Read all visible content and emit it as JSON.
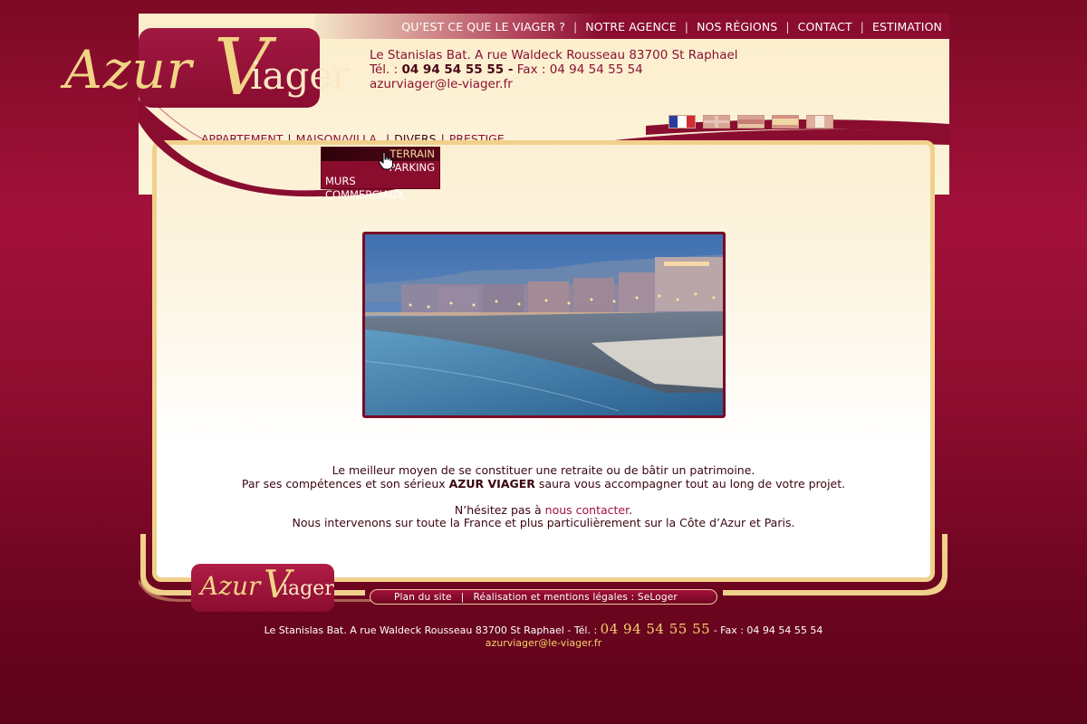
{
  "brand": {
    "logo_part1": "Azur",
    "logo_part2": "V",
    "logo_part3": "iager",
    "colors": {
      "primary": "#8a0d30",
      "gold": "#f1d486",
      "cream": "#fdf3dc"
    }
  },
  "topnav": {
    "items": [
      {
        "label": "QU’EST CE QUE LE VIAGER ?"
      },
      {
        "label": "NOTRE AGENCE"
      },
      {
        "label": "NOS RÉGIONS"
      },
      {
        "label": "CONTACT"
      },
      {
        "label": "ESTIMATION"
      }
    ],
    "separator": "|"
  },
  "contact": {
    "address": "Le Stanislas Bat. A rue Waldeck Rousseau 83700 St Raphael",
    "tel_label": "Tél. :",
    "tel_number": "04 94 54 55 55 -",
    "fax": "Fax : 04 94 54 55 54",
    "email": "azurviager@le-viager.fr"
  },
  "languages": [
    {
      "icon": "flag-fr-icon"
    },
    {
      "icon": "flag-uk-icon"
    },
    {
      "icon": "flag-de-icon"
    },
    {
      "icon": "flag-es-icon"
    },
    {
      "icon": "flag-it-icon"
    }
  ],
  "mainmenu": {
    "items": [
      {
        "label": "APPARTEMENT"
      },
      {
        "label": "MAISON/VILLA"
      },
      {
        "label": "DIVERS"
      },
      {
        "label": "PRESTIGE"
      }
    ],
    "separator": "|",
    "submenu": [
      {
        "label": "TERRAIN"
      },
      {
        "label": "PARKING"
      },
      {
        "label": "MURS COMMERCIAUX"
      }
    ]
  },
  "intro": {
    "line1": "Le meilleur moyen de se constituer une retraite ou de bâtir un patrimoine.",
    "line2_before": "Par ses compétences et son sérieux ",
    "line2_bold": "AZUR VIAGER",
    "line2_after": " saura vous accompagner tout au long de votre projet.",
    "line3_before": "N’hésitez pas à ",
    "line3_link": "nous contacter",
    "line3_after": ".",
    "line4": "Nous intervenons sur toute la France et plus particulièrement sur la Côte d’Azur et Paris."
  },
  "footer": {
    "logo_part1": "Azur",
    "logo_part2": "V",
    "logo_part3": "iager",
    "links": [
      {
        "label": "Plan du site"
      },
      {
        "label": "Réalisation et mentions légales : SeLoger"
      }
    ],
    "separator": "|",
    "address": "Le Stanislas Bat. A rue Waldeck Rousseau 83700 St Raphael - Tél. :",
    "phone": "04 94 54 55 55",
    "fax": "- Fax : 04 94 54 55 54",
    "email": "azurviager@le-viager.fr"
  }
}
